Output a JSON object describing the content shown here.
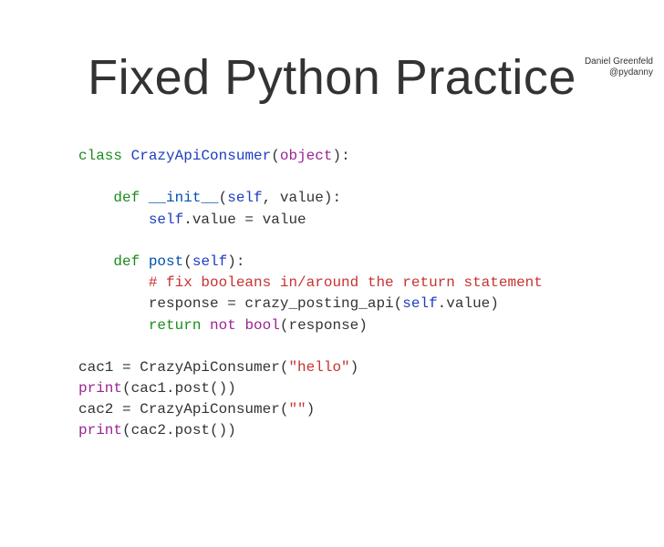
{
  "attribution": {
    "name": "Daniel Greenfeld",
    "handle": "@pydanny"
  },
  "title": "Fixed Python Practice",
  "code": {
    "l1_class": "class",
    "l1_name": "CrazyApiConsumer",
    "l1_obj": "object",
    "l2_def": "def",
    "l2_fn": "__init__",
    "l2_self": "self",
    "l2_param": ", value):",
    "l3_self": "self",
    "l3_rest": ".value = value",
    "l4_def": "def",
    "l4_fn": "post",
    "l4_self": "self",
    "l5_comment": "# fix booleans in/around the return statement",
    "l6_pre": "        response = crazy_posting_api(",
    "l6_self": "self",
    "l6_post": ".value)",
    "l7_return": "return",
    "l7_not": "not",
    "l7_bool": "bool",
    "l7_post": "(response)",
    "l8_pre": "cac1 = CrazyApiConsumer(",
    "l8_str": "\"hello\"",
    "l8_post": ")",
    "l9_print": "print",
    "l9_post": "(cac1.post())",
    "l10_pre": "cac2 = CrazyApiConsumer(",
    "l10_str": "\"\"",
    "l10_post": ")",
    "l11_print": "print",
    "l11_post": "(cac2.post())"
  }
}
